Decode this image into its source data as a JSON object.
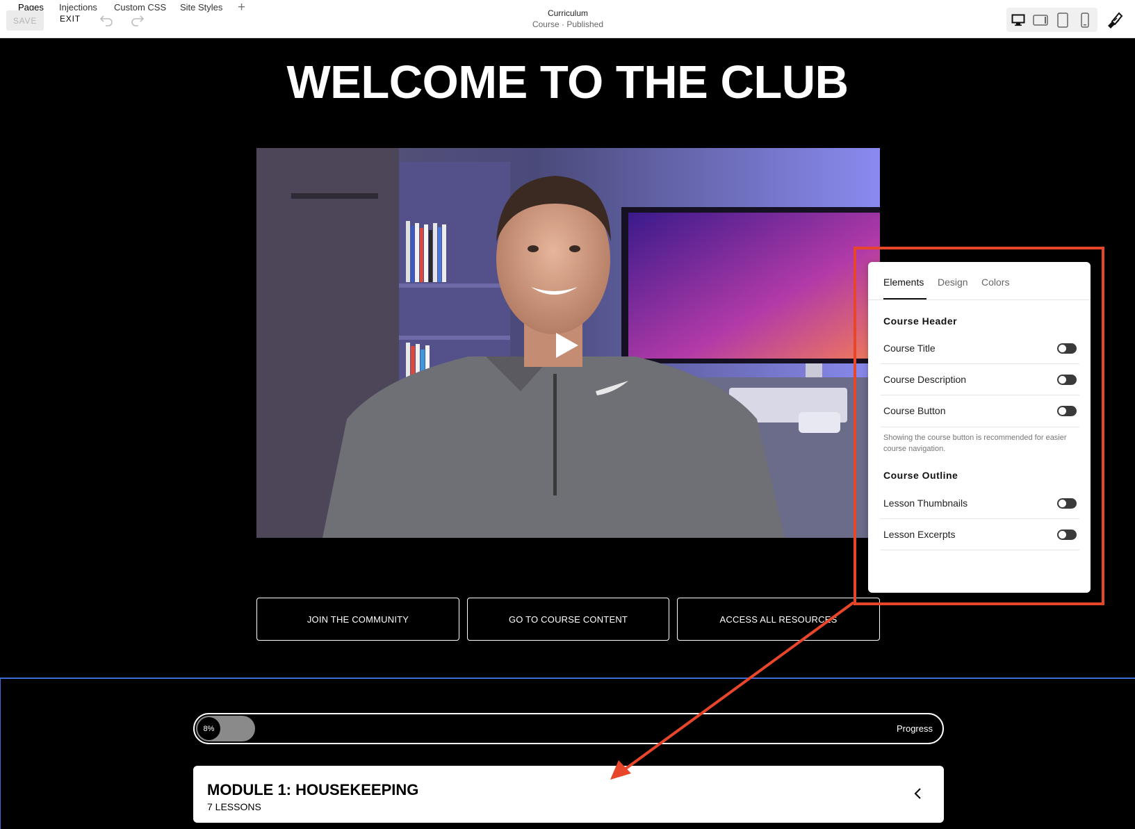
{
  "topbar": {
    "nav": [
      "Pages",
      "Injections",
      "Custom CSS",
      "Site Styles"
    ],
    "save_label": "SAVE",
    "exit_label": "EXIT",
    "add_symbol": "+",
    "page_title": "Curriculum",
    "page_status": "Course · Published",
    "device_icons": [
      "desktop-icon",
      "tablet-landscape-icon",
      "tablet-portrait-icon",
      "mobile-icon"
    ],
    "design_icon": "paintbrush-icon"
  },
  "page": {
    "headline": "WELCOME TO THE CLUB",
    "buttons": [
      "JOIN THE COMMUNITY",
      "GO TO COURSE CONTENT",
      "ACCESS ALL RESOURCES"
    ],
    "progress": {
      "percent_label": "8%",
      "value_percent": 8,
      "label": "Progress"
    },
    "module": {
      "title": "MODULE 1: HOUSEKEEPING",
      "subtitle": "7 LESSONS"
    }
  },
  "panel": {
    "tabs": [
      "Elements",
      "Design",
      "Colors"
    ],
    "active_tab": "Elements",
    "course_header": {
      "title": "Course Header",
      "items": [
        {
          "label": "Course Title",
          "on": false
        },
        {
          "label": "Course Description",
          "on": false
        },
        {
          "label": "Course Button",
          "on": false
        }
      ],
      "hint": "Showing the course button is recommended for easier course navigation."
    },
    "course_outline": {
      "title": "Course Outline",
      "items": [
        {
          "label": "Lesson Thumbnails",
          "on": false
        },
        {
          "label": "Lesson Excerpts",
          "on": false
        }
      ]
    }
  },
  "colors": {
    "annotation": "#e8462a",
    "section_outline": "#3d6bd8",
    "page_background": "#000000"
  }
}
